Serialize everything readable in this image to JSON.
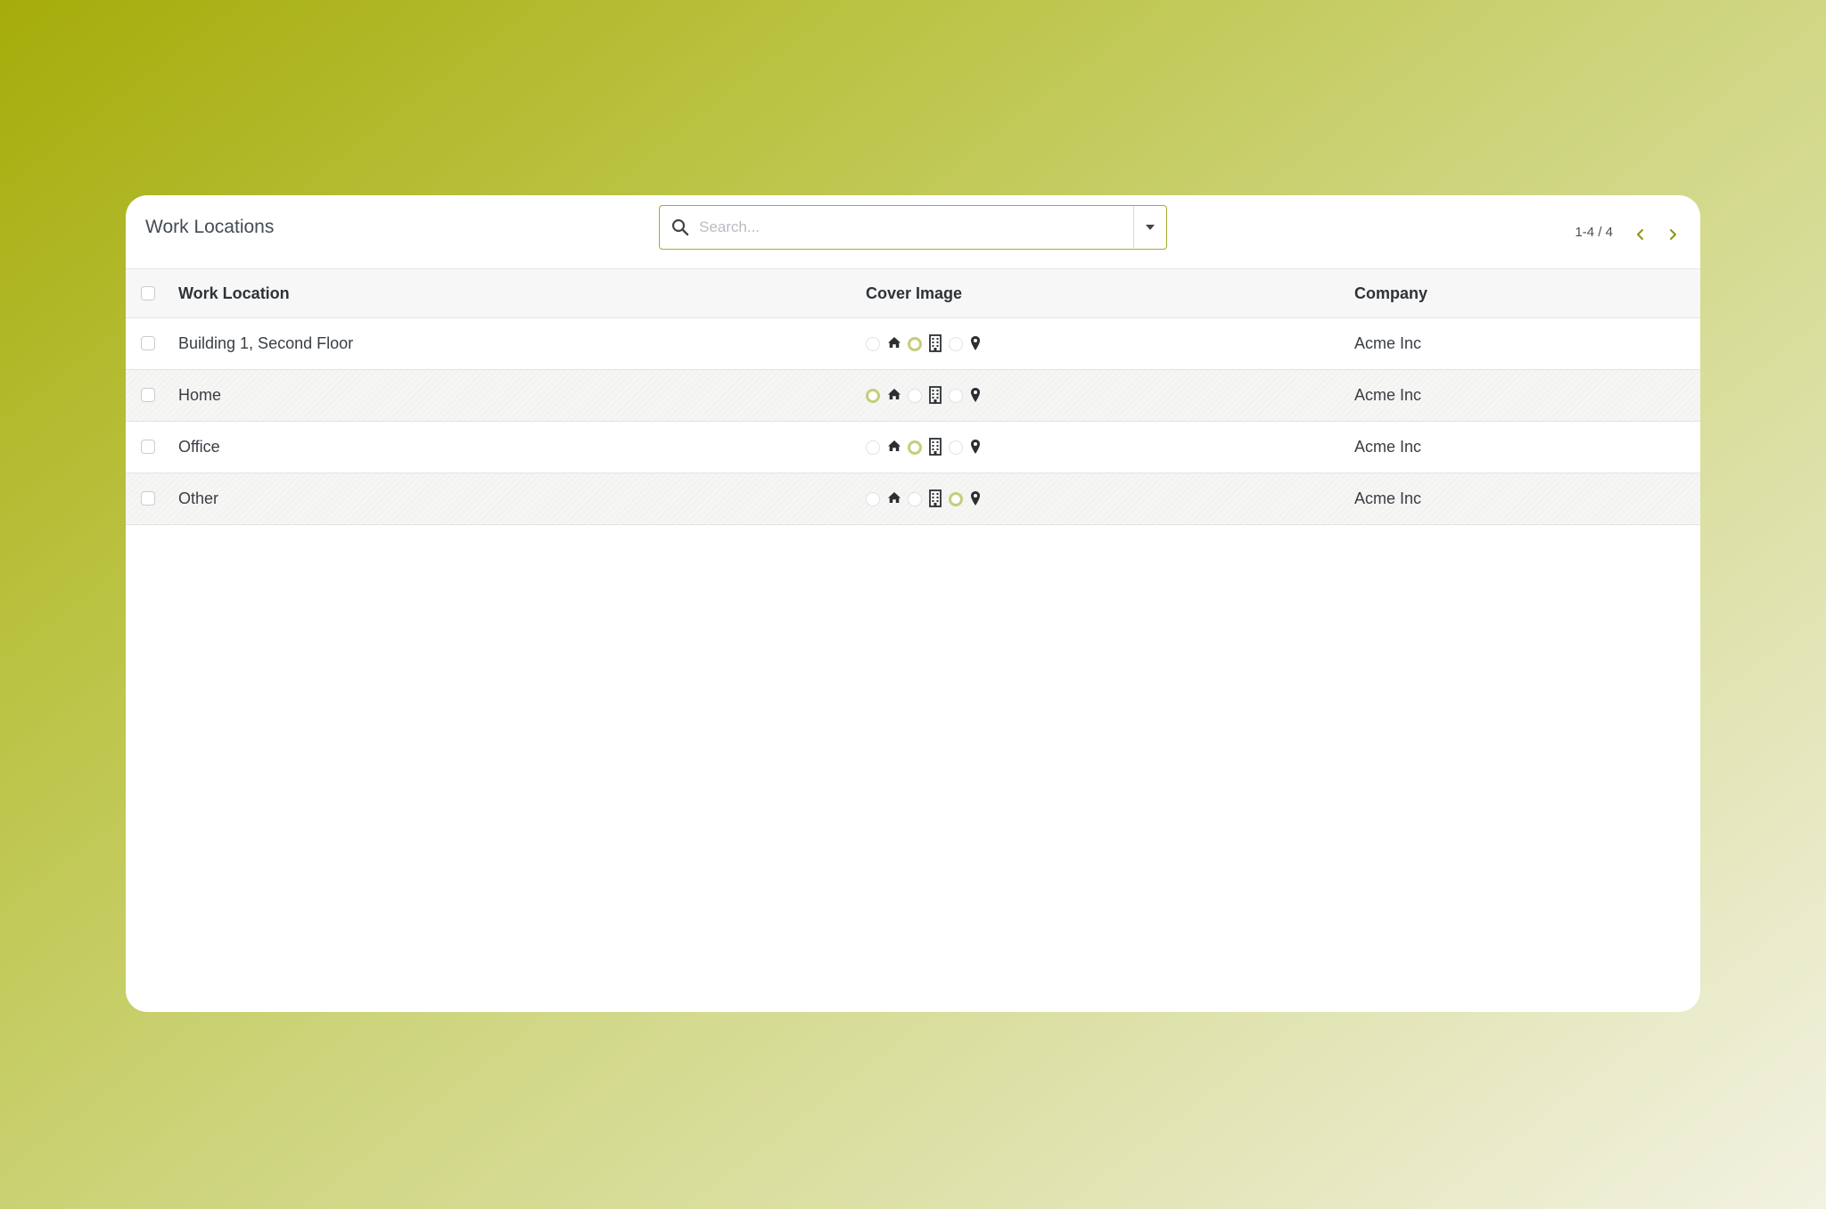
{
  "header": {
    "title": "Work Locations",
    "search_placeholder": "Search...",
    "pager_text": "1-4 / 4"
  },
  "table": {
    "columns": [
      "Work Location",
      "Cover Image",
      "Company"
    ],
    "rows": [
      {
        "name": "Building 1, Second Floor",
        "cover_selected": "office",
        "company": "Acme Inc"
      },
      {
        "name": "Home",
        "cover_selected": "home",
        "company": "Acme Inc"
      },
      {
        "name": "Office",
        "cover_selected": "office",
        "company": "Acme Inc"
      },
      {
        "name": "Other",
        "cover_selected": "other",
        "company": "Acme Inc"
      }
    ],
    "cover_options": [
      "home",
      "office",
      "other"
    ]
  },
  "colors": {
    "accent": "#a4ab27",
    "radio_selected": "#c6cd7c"
  },
  "icons": [
    "search-icon",
    "caret-down-icon",
    "chevron-left-icon",
    "chevron-right-icon",
    "home-icon",
    "building-icon",
    "map-marker-icon"
  ]
}
